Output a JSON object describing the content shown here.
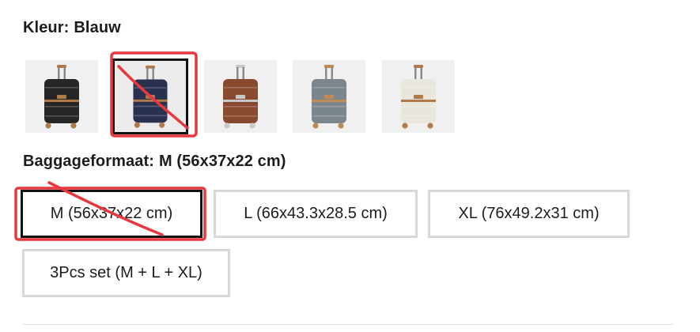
{
  "color_section": {
    "label": "Kleur:",
    "value": "Blauw",
    "swatches": [
      {
        "name": "Zwart",
        "body": "#262626",
        "trim": "#b07a4a",
        "selected": false
      },
      {
        "name": "Blauw",
        "body": "#2a3150",
        "trim": "#b07a4a",
        "selected": true
      },
      {
        "name": "Bruin",
        "body": "#8a4a2f",
        "trim": "#c9c9c9",
        "selected": false
      },
      {
        "name": "Grijs",
        "body": "#7b858c",
        "trim": "#c08a55",
        "selected": false
      },
      {
        "name": "Wit",
        "body": "#e9e6dd",
        "trim": "#b07a4a",
        "selected": false
      }
    ]
  },
  "size_section": {
    "label": "Baggageformaat:",
    "value": "M (56x37x22 cm)",
    "options": [
      {
        "label": "M (56x37x22 cm)",
        "selected": true
      },
      {
        "label": "L (66x43.3x28.5 cm)",
        "selected": false
      },
      {
        "label": "XL (76x49.2x31 cm)",
        "selected": false
      },
      {
        "label": "3Pcs set (M + L + XL)",
        "selected": false
      }
    ]
  },
  "annotation_color": "#e8383d"
}
